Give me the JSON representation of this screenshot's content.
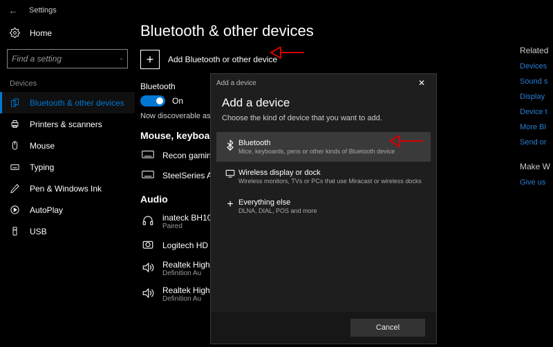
{
  "topbar": {
    "title": "Settings"
  },
  "sidebar": {
    "home": "Home",
    "search_placeholder": "Find a setting",
    "heading": "Devices",
    "items": [
      {
        "label": "Bluetooth & other devices"
      },
      {
        "label": "Printers & scanners"
      },
      {
        "label": "Mouse"
      },
      {
        "label": "Typing"
      },
      {
        "label": "Pen & Windows Ink"
      },
      {
        "label": "AutoPlay"
      },
      {
        "label": "USB"
      }
    ]
  },
  "main": {
    "title": "Bluetooth & other devices",
    "add_label": "Add Bluetooth or other device",
    "bt_label": "Bluetooth",
    "bt_state": "On",
    "discoverable": "Now discoverable as",
    "mouse_heading": "Mouse, keyboa",
    "devices_mk": [
      {
        "name": "Recon gaming"
      },
      {
        "name": "SteelSeries Ap"
      }
    ],
    "audio_heading": "Audio",
    "devices_audio": [
      {
        "name": "inateck BH100",
        "sub": "Paired"
      },
      {
        "name": "Logitech HD "
      },
      {
        "name": "Realtek High ",
        "sub": "Definition Au"
      },
      {
        "name": "Realtek High ",
        "sub": "Definition Au"
      }
    ]
  },
  "rightcol": {
    "heading1": "Related",
    "links1": [
      "Devices",
      "Sound s",
      "Display",
      "Device t",
      "More Bl",
      "Send or"
    ],
    "heading2": "Make W",
    "links2": [
      "Give us"
    ]
  },
  "dialog": {
    "titlebar": "Add a device",
    "heading": "Add a device",
    "sub": "Choose the kind of device that you want to add.",
    "options": [
      {
        "name": "Bluetooth",
        "sub": "Mice, keyboards, pens or other kinds of Bluetooth device"
      },
      {
        "name": "Wireless display or dock",
        "sub": "Wireless monitors, TVs or PCs that use Miracast or wireless docks"
      },
      {
        "name": "Everything else",
        "sub": "DLNA, DIAL, POS and more"
      }
    ],
    "cancel": "Cancel"
  }
}
